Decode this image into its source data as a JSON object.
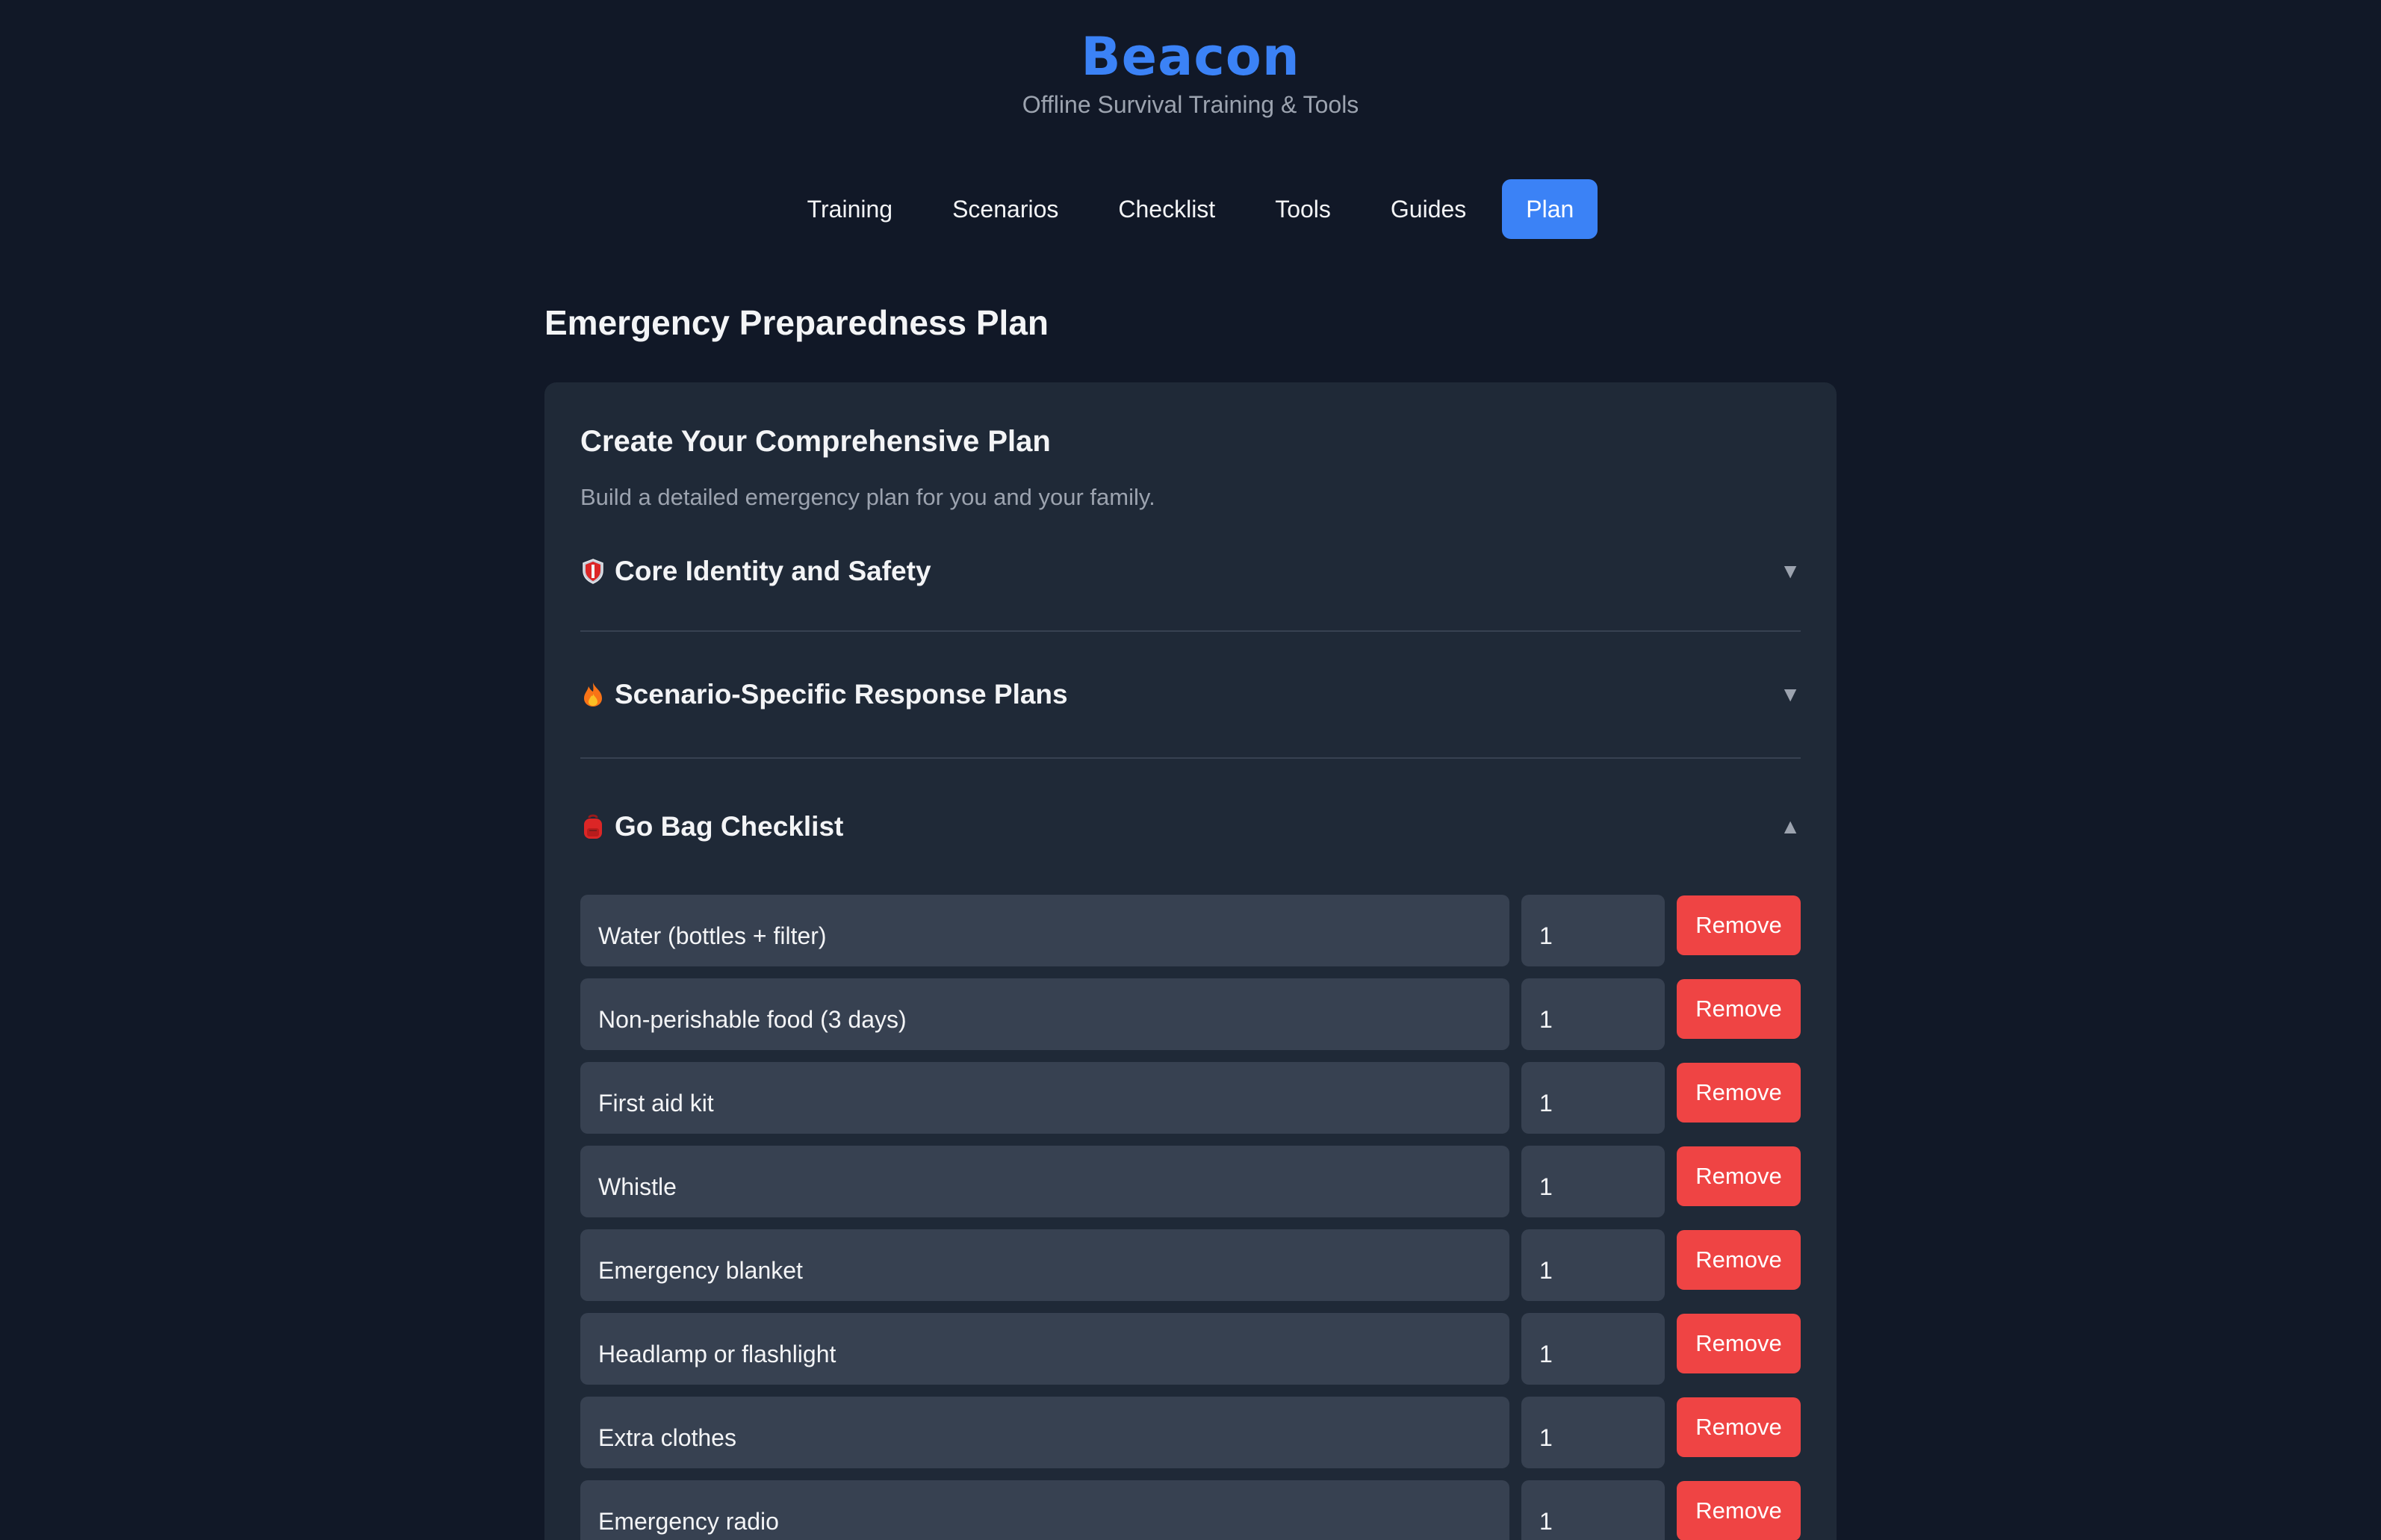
{
  "app": {
    "title": "Beacon",
    "subtitle": "Offline Survival Training & Tools"
  },
  "nav": {
    "tabs": [
      "Training",
      "Scenarios",
      "Checklist",
      "Tools",
      "Guides",
      "Plan"
    ],
    "active": "Plan"
  },
  "page": {
    "title": "Emergency Preparedness Plan"
  },
  "card": {
    "title": "Create Your Comprehensive Plan",
    "description": "Build a detailed emergency plan for you and your family."
  },
  "sections": [
    {
      "icon": "shield-icon",
      "title": "Core Identity and Safety",
      "expanded": false,
      "chevron": "▼"
    },
    {
      "icon": "fire-icon",
      "title": "Scenario-Specific Response Plans",
      "expanded": false,
      "chevron": "▼"
    },
    {
      "icon": "backpack-icon",
      "title": "Go Bag Checklist",
      "expanded": true,
      "chevron": "▲"
    }
  ],
  "go_bag": {
    "remove_label": "Remove",
    "items": [
      {
        "name": "Water (bottles + filter)",
        "qty": "1"
      },
      {
        "name": "Non-perishable food (3 days)",
        "qty": "1"
      },
      {
        "name": "First aid kit",
        "qty": "1"
      },
      {
        "name": "Whistle",
        "qty": "1"
      },
      {
        "name": "Emergency blanket",
        "qty": "1"
      },
      {
        "name": "Headlamp or flashlight",
        "qty": "1"
      },
      {
        "name": "Extra clothes",
        "qty": "1"
      },
      {
        "name": "Emergency radio",
        "qty": "1"
      }
    ]
  },
  "colors": {
    "background": "#111827",
    "card": "#1f2937",
    "field": "#374151",
    "accent": "#3b82f6",
    "danger": "#ef4444"
  }
}
